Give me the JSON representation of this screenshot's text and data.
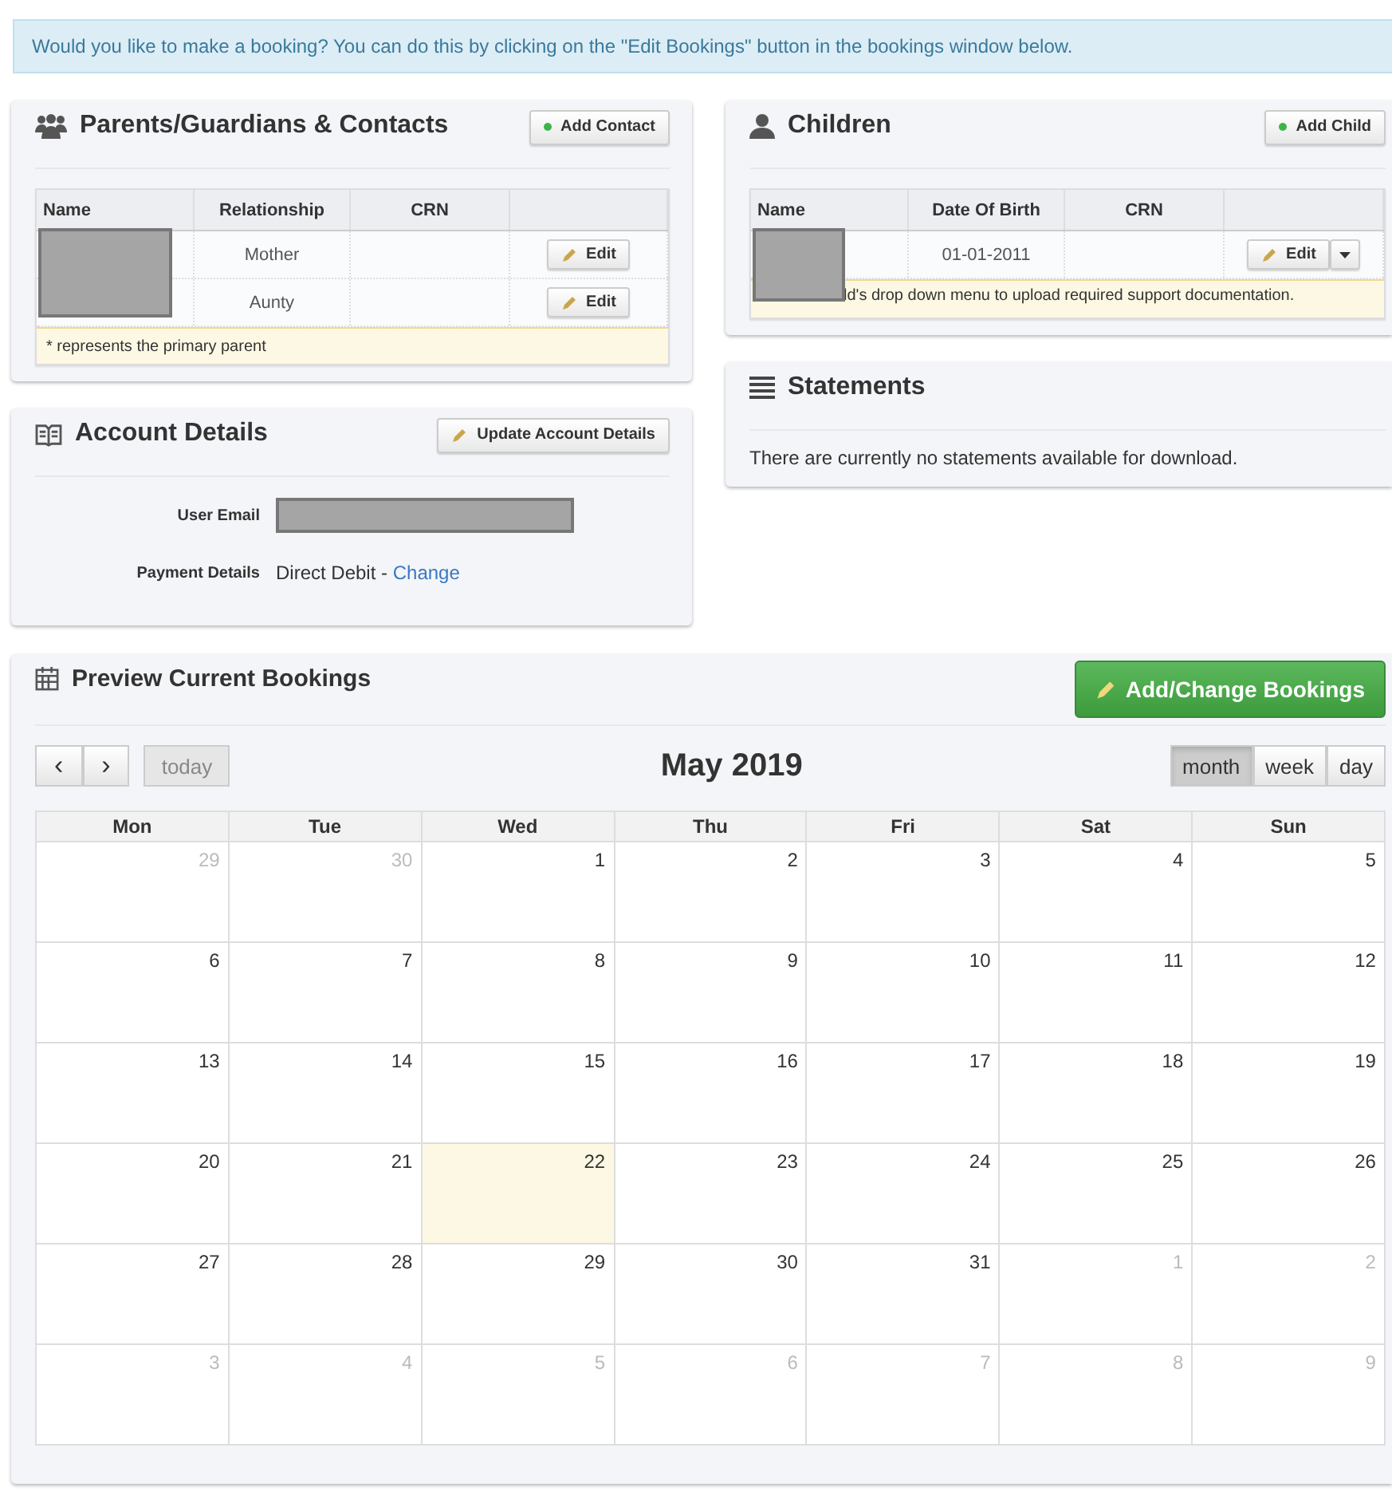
{
  "notice": "Would you like to make a booking? You can do this by clicking on the \"Edit Bookings\" button in the bookings window below.",
  "contacts": {
    "title": "Parents/Guardians & Contacts",
    "add_button": "Add Contact",
    "columns": [
      "Name",
      "Relationship",
      "CRN",
      ""
    ],
    "rows": [
      {
        "relationship": "Mother",
        "action": "Edit"
      },
      {
        "relationship": "Aunty",
        "action": "Edit"
      }
    ],
    "note": "* represents the primary parent"
  },
  "children": {
    "title": "Children",
    "add_button": "Add Child",
    "columns": [
      "Name",
      "Date Of Birth",
      "CRN",
      ""
    ],
    "rows": [
      {
        "date_of_birth": "01-01-2011",
        "action": "Edit"
      }
    ],
    "note": "ld's drop down menu to upload required support documentation."
  },
  "account": {
    "title": "Account Details",
    "update_button": "Update Account Details",
    "email_label": "User Email",
    "payment_label": "Payment Details",
    "payment_value": "Direct Debit - ",
    "payment_link": "Change"
  },
  "statements": {
    "title": "Statements",
    "message": "There are currently no statements available for download."
  },
  "bookings": {
    "title": "Preview Current Bookings",
    "add_button": "Add/Change Bookings",
    "prev": "‹",
    "next": "›",
    "today_button": "today",
    "month_title": "May 2019",
    "views": [
      {
        "label": "month",
        "selected": true
      },
      {
        "label": "week",
        "selected": false
      },
      {
        "label": "day",
        "selected": false
      }
    ],
    "weekdays": [
      "Mon",
      "Tue",
      "Wed",
      "Thu",
      "Fri",
      "Sat",
      "Sun"
    ],
    "weeks": [
      [
        {
          "day": "29",
          "outside": true,
          "today": false
        },
        {
          "day": "30",
          "outside": true,
          "today": false
        },
        {
          "day": "1",
          "outside": false,
          "today": false
        },
        {
          "day": "2",
          "outside": false,
          "today": false
        },
        {
          "day": "3",
          "outside": false,
          "today": false
        },
        {
          "day": "4",
          "outside": false,
          "today": false
        },
        {
          "day": "5",
          "outside": false,
          "today": false
        }
      ],
      [
        {
          "day": "6",
          "outside": false,
          "today": false
        },
        {
          "day": "7",
          "outside": false,
          "today": false
        },
        {
          "day": "8",
          "outside": false,
          "today": false
        },
        {
          "day": "9",
          "outside": false,
          "today": false
        },
        {
          "day": "10",
          "outside": false,
          "today": false
        },
        {
          "day": "11",
          "outside": false,
          "today": false
        },
        {
          "day": "12",
          "outside": false,
          "today": false
        }
      ],
      [
        {
          "day": "13",
          "outside": false,
          "today": false
        },
        {
          "day": "14",
          "outside": false,
          "today": false
        },
        {
          "day": "15",
          "outside": false,
          "today": false
        },
        {
          "day": "16",
          "outside": false,
          "today": false
        },
        {
          "day": "17",
          "outside": false,
          "today": false
        },
        {
          "day": "18",
          "outside": false,
          "today": false
        },
        {
          "day": "19",
          "outside": false,
          "today": false
        }
      ],
      [
        {
          "day": "20",
          "outside": false,
          "today": false
        },
        {
          "day": "21",
          "outside": false,
          "today": false
        },
        {
          "day": "22",
          "outside": false,
          "today": true
        },
        {
          "day": "23",
          "outside": false,
          "today": false
        },
        {
          "day": "24",
          "outside": false,
          "today": false
        },
        {
          "day": "25",
          "outside": false,
          "today": false
        },
        {
          "day": "26",
          "outside": false,
          "today": false
        }
      ],
      [
        {
          "day": "27",
          "outside": false,
          "today": false
        },
        {
          "day": "28",
          "outside": false,
          "today": false
        },
        {
          "day": "29",
          "outside": false,
          "today": false
        },
        {
          "day": "30",
          "outside": false,
          "today": false
        },
        {
          "day": "31",
          "outside": false,
          "today": false
        },
        {
          "day": "1",
          "outside": true,
          "today": false
        },
        {
          "day": "2",
          "outside": true,
          "today": false
        }
      ],
      [
        {
          "day": "3",
          "outside": true,
          "today": false
        },
        {
          "day": "4",
          "outside": true,
          "today": false
        },
        {
          "day": "5",
          "outside": true,
          "today": false
        },
        {
          "day": "6",
          "outside": true,
          "today": false
        },
        {
          "day": "7",
          "outside": true,
          "today": false
        },
        {
          "day": "8",
          "outside": true,
          "today": false
        },
        {
          "day": "9",
          "outside": true,
          "today": false
        }
      ]
    ]
  }
}
